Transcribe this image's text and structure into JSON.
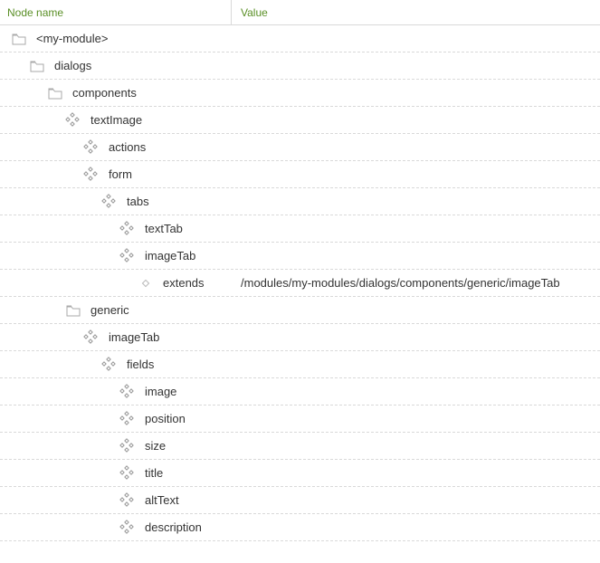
{
  "columns": {
    "name": "Node name",
    "value": "Value"
  },
  "rows": [
    {
      "indent": 0,
      "icon": "folder",
      "name": "<my-module>",
      "value": ""
    },
    {
      "indent": 1,
      "icon": "folder",
      "name": "dialogs",
      "value": ""
    },
    {
      "indent": 2,
      "icon": "folder",
      "name": "components",
      "value": ""
    },
    {
      "indent": 3,
      "icon": "content",
      "name": "textImage",
      "value": ""
    },
    {
      "indent": 4,
      "icon": "content",
      "name": "actions",
      "value": ""
    },
    {
      "indent": 4,
      "icon": "content",
      "name": "form",
      "value": ""
    },
    {
      "indent": 5,
      "icon": "content",
      "name": "tabs",
      "value": ""
    },
    {
      "indent": 6,
      "icon": "content",
      "name": "textTab",
      "value": ""
    },
    {
      "indent": 6,
      "icon": "content",
      "name": "imageTab",
      "value": ""
    },
    {
      "indent": 7,
      "icon": "prop",
      "name": "extends",
      "value": "/modules/my-modules/dialogs/components/generic/imageTab"
    },
    {
      "indent": 3,
      "icon": "folder",
      "name": "generic",
      "value": ""
    },
    {
      "indent": 4,
      "icon": "content",
      "name": "imageTab",
      "value": ""
    },
    {
      "indent": 5,
      "icon": "content",
      "name": "fields",
      "value": ""
    },
    {
      "indent": 6,
      "icon": "content",
      "name": "image",
      "value": ""
    },
    {
      "indent": 6,
      "icon": "content",
      "name": "position",
      "value": ""
    },
    {
      "indent": 6,
      "icon": "content",
      "name": "size",
      "value": ""
    },
    {
      "indent": 6,
      "icon": "content",
      "name": "title",
      "value": ""
    },
    {
      "indent": 6,
      "icon": "content",
      "name": "altText",
      "value": ""
    },
    {
      "indent": 6,
      "icon": "content",
      "name": "description",
      "value": ""
    }
  ]
}
